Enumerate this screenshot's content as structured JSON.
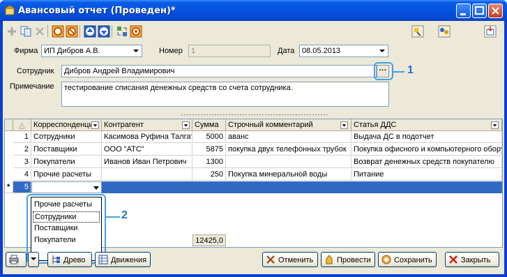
{
  "window": {
    "title": "Авансовый отчет (Проведен)*",
    "controls": [
      "minimize",
      "maximize",
      "close"
    ]
  },
  "toolbar": {
    "icons": [
      "add-icon",
      "copy-icon",
      "delete-icon",
      "mark-delete-icon",
      "unmark-icon",
      "move-up-icon",
      "move-down-icon",
      "sort-icon",
      "settings-icon"
    ],
    "right_icons": [
      "structure-icon",
      "users-icon",
      "exit-icon"
    ]
  },
  "header": {
    "firm_label": "Фирма",
    "firm_value": "ИП Дибров А.В.",
    "number_label": "Номер",
    "number_value": "1",
    "date_label": "Дата",
    "date_value": "08.05.2013",
    "employee_label": "Сотрудник",
    "employee_value": "Дибров Андрей Владимирович",
    "employee_button": "···",
    "note_label": "Примечание",
    "note_value": "тестирование списания денежных средств со счета сотрудника."
  },
  "grid": {
    "columns": [
      "Корреспонденция",
      "Контрагент",
      "Сумма",
      "Строчный комментарий",
      "Статья ДДС"
    ],
    "rows": [
      {
        "n": "1",
        "corr": "Сотрудники",
        "contr": "Касимова Руфина Талгатовна",
        "sum": "5000",
        "comment": "аванс",
        "dds": "Выдача ДС в подотчет"
      },
      {
        "n": "2",
        "corr": "Поставщики",
        "contr": "ООО \"АТС\"",
        "sum": "5875",
        "comment": "покупка двух телефонных трубок",
        "dds": "Покупка офисного и компьютерного оборудования"
      },
      {
        "n": "3",
        "corr": "Покупатели",
        "contr": "Иванов Иван Петрович",
        "sum": "1300",
        "comment": "",
        "dds": "Возврат денежных средств покупателю"
      },
      {
        "n": "4",
        "corr": "Прочие расчеты",
        "contr": "",
        "sum": "250",
        "comment": "Покупка минеральной воды",
        "dds": "Питание"
      },
      {
        "n": "5",
        "corr": "",
        "contr": "",
        "sum": "",
        "comment": "",
        "dds": ""
      }
    ],
    "new_row_marker": "*",
    "total": "12425,0"
  },
  "dropdown": {
    "options": [
      "Прочие расчеты",
      "Сотрудники",
      "Поставщики",
      "Покупатели"
    ],
    "highlighted": "Сотрудники"
  },
  "annotations": {
    "callout_1": "1",
    "callout_2": "2"
  },
  "footer": {
    "print_label": "",
    "tree_label": "Древо",
    "movements_label": "Движения",
    "cancel_label": "Отменить",
    "post_label": "Провести",
    "save_label": "Сохранить",
    "close_label": "Закрыть"
  },
  "colors": {
    "title_bar": "#0453e0",
    "selection": "#316ac5",
    "callout": "#1f6fd6",
    "panel": "#ece9d8"
  }
}
